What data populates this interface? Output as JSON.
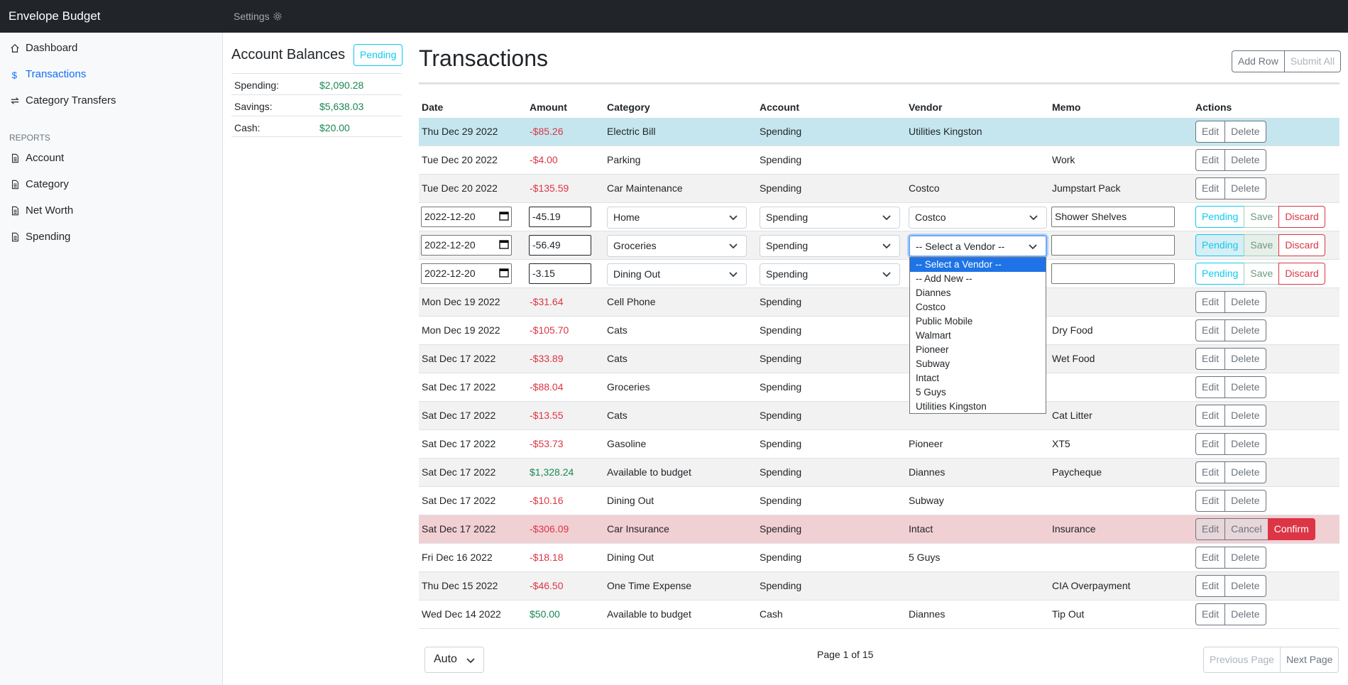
{
  "app": {
    "brand": "Envelope Budget",
    "settings_label": "Settings"
  },
  "sidebar": {
    "items": [
      {
        "label": "Dashboard",
        "icon": "home-icon"
      },
      {
        "label": "Transactions",
        "icon": "dollar-icon",
        "active": true
      },
      {
        "label": "Category Transfers",
        "icon": "transfer-icon"
      }
    ],
    "reports_heading": "REPORTS",
    "reports": [
      {
        "label": "Account",
        "icon": "document-icon"
      },
      {
        "label": "Category",
        "icon": "document-icon"
      },
      {
        "label": "Net Worth",
        "icon": "document-icon"
      },
      {
        "label": "Spending",
        "icon": "document-icon"
      }
    ]
  },
  "balances": {
    "title": "Account Balances",
    "pending_label": "Pending",
    "rows": [
      {
        "label": "Spending:",
        "amount": "$2,090.28"
      },
      {
        "label": "Savings:",
        "amount": "$5,638.03"
      },
      {
        "label": "Cash:",
        "amount": "$20.00"
      }
    ]
  },
  "main": {
    "title": "Transactions",
    "add_row": "Add Row",
    "submit_all": "Submit All",
    "columns": [
      "Date",
      "Amount",
      "Category",
      "Account",
      "Vendor",
      "Memo",
      "Actions"
    ]
  },
  "rows_top": [
    {
      "date": "Thu Dec 29 2022",
      "amount": "-$85.26",
      "category": "Electric Bill",
      "account": "Spending",
      "vendor": "Utilities Kingston",
      "memo": ""
    },
    {
      "date": "Tue Dec 20 2022",
      "amount": "-$4.00",
      "category": "Parking",
      "account": "Spending",
      "vendor": "",
      "memo": "Work"
    },
    {
      "date": "Tue Dec 20 2022",
      "amount": "-$135.59",
      "category": "Car Maintenance",
      "account": "Spending",
      "vendor": "Costco",
      "memo": "Jumpstart Pack"
    }
  ],
  "edit_rows": [
    {
      "date": "2022-12-20",
      "amount": "-45.19",
      "category": "Home",
      "account": "Spending",
      "vendor": "Costco",
      "memo": "Shower Shelves"
    },
    {
      "date": "2022-12-20",
      "amount": "-56.49",
      "category": "Groceries",
      "account": "Spending",
      "vendor": "-- Select a Vendor --",
      "memo": ""
    },
    {
      "date": "2022-12-20",
      "amount": "-3.15",
      "category": "Dining Out",
      "account": "Spending",
      "vendor": "",
      "memo": ""
    }
  ],
  "edit_actions": {
    "pending": "Pending",
    "save": "Save",
    "discard": "Discard"
  },
  "row_actions": {
    "edit": "Edit",
    "delete": "Delete",
    "cancel": "Cancel",
    "confirm": "Confirm"
  },
  "rows_bottom": [
    {
      "date": "Mon Dec 19 2022",
      "amount": "-$31.64",
      "category": "Cell Phone",
      "account": "Spending",
      "vendor": "",
      "memo": ""
    },
    {
      "date": "Mon Dec 19 2022",
      "amount": "-$105.70",
      "category": "Cats",
      "account": "Spending",
      "vendor": "",
      "memo": "Dry Food"
    },
    {
      "date": "Sat Dec 17 2022",
      "amount": "-$33.89",
      "category": "Cats",
      "account": "Spending",
      "vendor": "",
      "memo": "Wet Food"
    },
    {
      "date": "Sat Dec 17 2022",
      "amount": "-$88.04",
      "category": "Groceries",
      "account": "Spending",
      "vendor": "",
      "memo": ""
    },
    {
      "date": "Sat Dec 17 2022",
      "amount": "-$13.55",
      "category": "Cats",
      "account": "Spending",
      "vendor": "",
      "memo": "Cat Litter"
    },
    {
      "date": "Sat Dec 17 2022",
      "amount": "-$53.73",
      "category": "Gasoline",
      "account": "Spending",
      "vendor": "Pioneer",
      "memo": "XT5"
    },
    {
      "date": "Sat Dec 17 2022",
      "amount": "$1,328.24",
      "category": "Available to budget",
      "account": "Spending",
      "vendor": "Diannes",
      "memo": "Paycheque"
    },
    {
      "date": "Sat Dec 17 2022",
      "amount": "-$10.16",
      "category": "Dining Out",
      "account": "Spending",
      "vendor": "Subway",
      "memo": ""
    },
    {
      "date": "Sat Dec 17 2022",
      "amount": "-$306.09",
      "category": "Car Insurance",
      "account": "Spending",
      "vendor": "Intact",
      "memo": "Insurance"
    },
    {
      "date": "Fri Dec 16 2022",
      "amount": "-$18.18",
      "category": "Dining Out",
      "account": "Spending",
      "vendor": "5 Guys",
      "memo": ""
    },
    {
      "date": "Thu Dec 15 2022",
      "amount": "-$46.50",
      "category": "One Time Expense",
      "account": "Spending",
      "vendor": "",
      "memo": "CIA Overpayment"
    },
    {
      "date": "Wed Dec 14 2022",
      "amount": "$50.00",
      "category": "Available to budget",
      "account": "Cash",
      "vendor": "Diannes",
      "memo": "Tip Out"
    }
  ],
  "vendor_dropdown": [
    "-- Select a Vendor --",
    "-- Add New --",
    "Diannes",
    "Costco",
    "Public Mobile",
    "Walmart",
    "Pioneer",
    "Subway",
    "Intact",
    "5 Guys",
    "Utilities Kingston"
  ],
  "footer": {
    "page_size": "Auto",
    "page_info": "Page 1 of 15",
    "prev": "Previous Page",
    "next": "Next Page"
  },
  "colors": {
    "negative": "#dc3545",
    "positive": "#198754",
    "info_row": "#c5e6ef",
    "danger_row": "#f1d0d4",
    "accent": "#0d6efd"
  }
}
